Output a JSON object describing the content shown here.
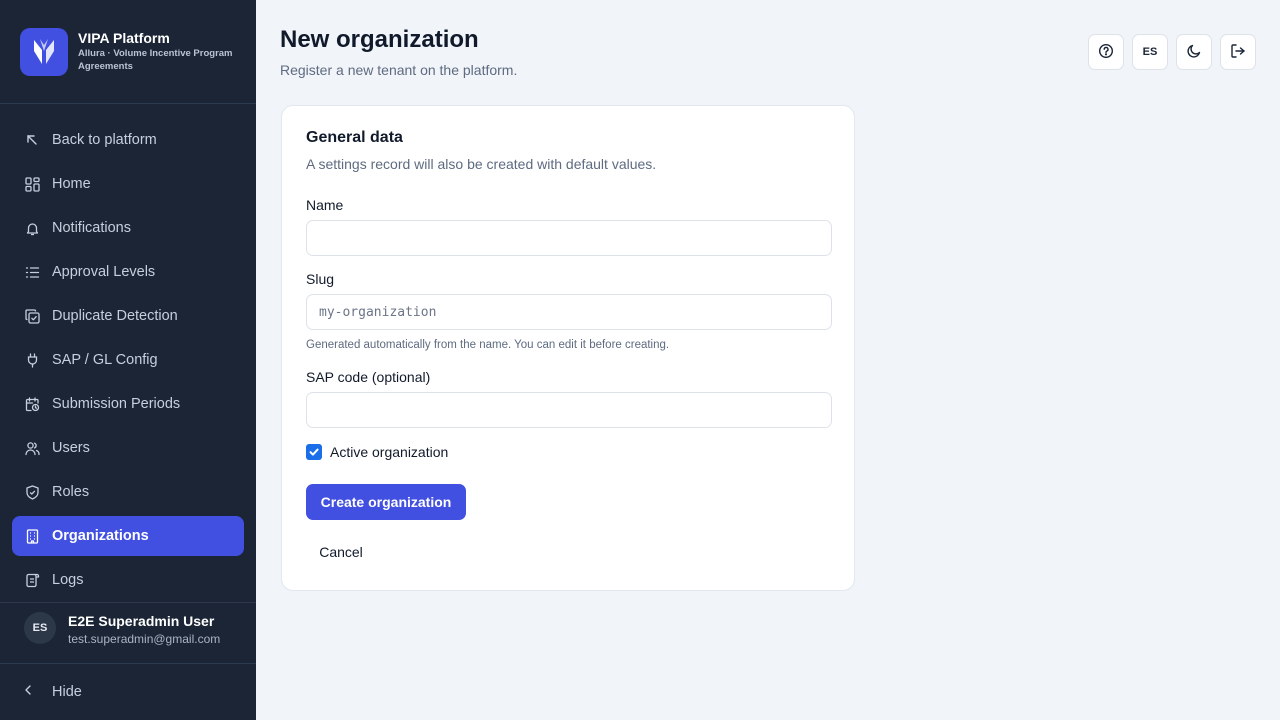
{
  "brand": {
    "title": "VIPA Platform",
    "subtitle": "Allura · Volume Incentive Program Agreements",
    "logo_icon": "vipa-leaf-logo",
    "accent": "#4150e0"
  },
  "sidebar": {
    "items": [
      {
        "label": "Back to platform",
        "icon": "arrow-up-left-icon"
      },
      {
        "label": "Home",
        "icon": "dashboard-icon"
      },
      {
        "label": "Notifications",
        "icon": "bell-icon"
      },
      {
        "label": "Approval Levels",
        "icon": "list-icon"
      },
      {
        "label": "Duplicate Detection",
        "icon": "copy-check-icon"
      },
      {
        "label": "SAP / GL Config",
        "icon": "plug-icon"
      },
      {
        "label": "Submission Periods",
        "icon": "calendar-clock-icon"
      },
      {
        "label": "Users",
        "icon": "users-icon"
      },
      {
        "label": "Roles",
        "icon": "shield-check-icon"
      },
      {
        "label": "Organizations",
        "icon": "building-icon",
        "active": true
      },
      {
        "label": "Logs",
        "icon": "scroll-icon"
      }
    ],
    "hide_label": "Hide"
  },
  "user": {
    "initials": "ES",
    "name": "E2E Superadmin User",
    "email": "test.superadmin@gmail.com"
  },
  "header": {
    "title": "New organization",
    "subtitle": "Register a new tenant on the platform.",
    "lang_label": "ES"
  },
  "form": {
    "title": "General data",
    "subtitle": "A settings record will also be created with default values.",
    "name_label": "Name",
    "name_value": "",
    "slug_label": "Slug",
    "slug_placeholder": "my-organization",
    "slug_hint": "Generated automatically from the name. You can edit it before creating.",
    "sap_label": "SAP code (optional)",
    "sap_value": "",
    "active_label": "Active organization",
    "active_checked": true,
    "create_label": "Create organization",
    "cancel_label": "Cancel"
  }
}
